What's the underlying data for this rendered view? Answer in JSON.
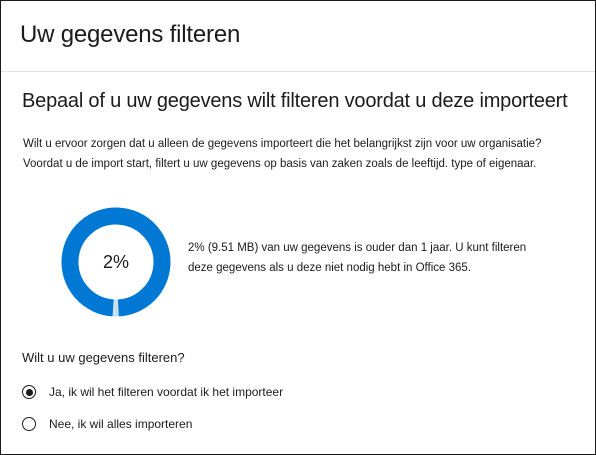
{
  "page": {
    "title": "Uw gegevens filteren"
  },
  "section": {
    "title": "Bepaal of u uw gegevens wilt filteren voordat u deze importeert",
    "intro_lines": [
      "Wilt u ervoor zorgen dat u alleen de gegevens importeert die het belangrijkst zijn voor uw organisatie?",
      "Voordat u de import start, filtert u uw gegevens op basis van zaken zoals de leeftijd. type of eigenaar."
    ]
  },
  "summary": {
    "percent_label": "2%",
    "percent_value": 0.02,
    "lines": [
      "2% (9.51 MB) van uw gegevens is ouder dan 1 jaar. U kunt filteren",
      "deze gegevens als u deze niet nodig hebt in Office 365."
    ],
    "colors": {
      "ring_main": "#0078d4",
      "ring_gap": "#c7e0f4"
    }
  },
  "filter_question": {
    "label": "Wilt u uw gegevens filteren?",
    "options": [
      {
        "label": "Ja, ik wil het filteren voordat ik het importeer",
        "selected": true
      },
      {
        "label": "Nee, ik wil alles importeren",
        "selected": false
      }
    ]
  }
}
